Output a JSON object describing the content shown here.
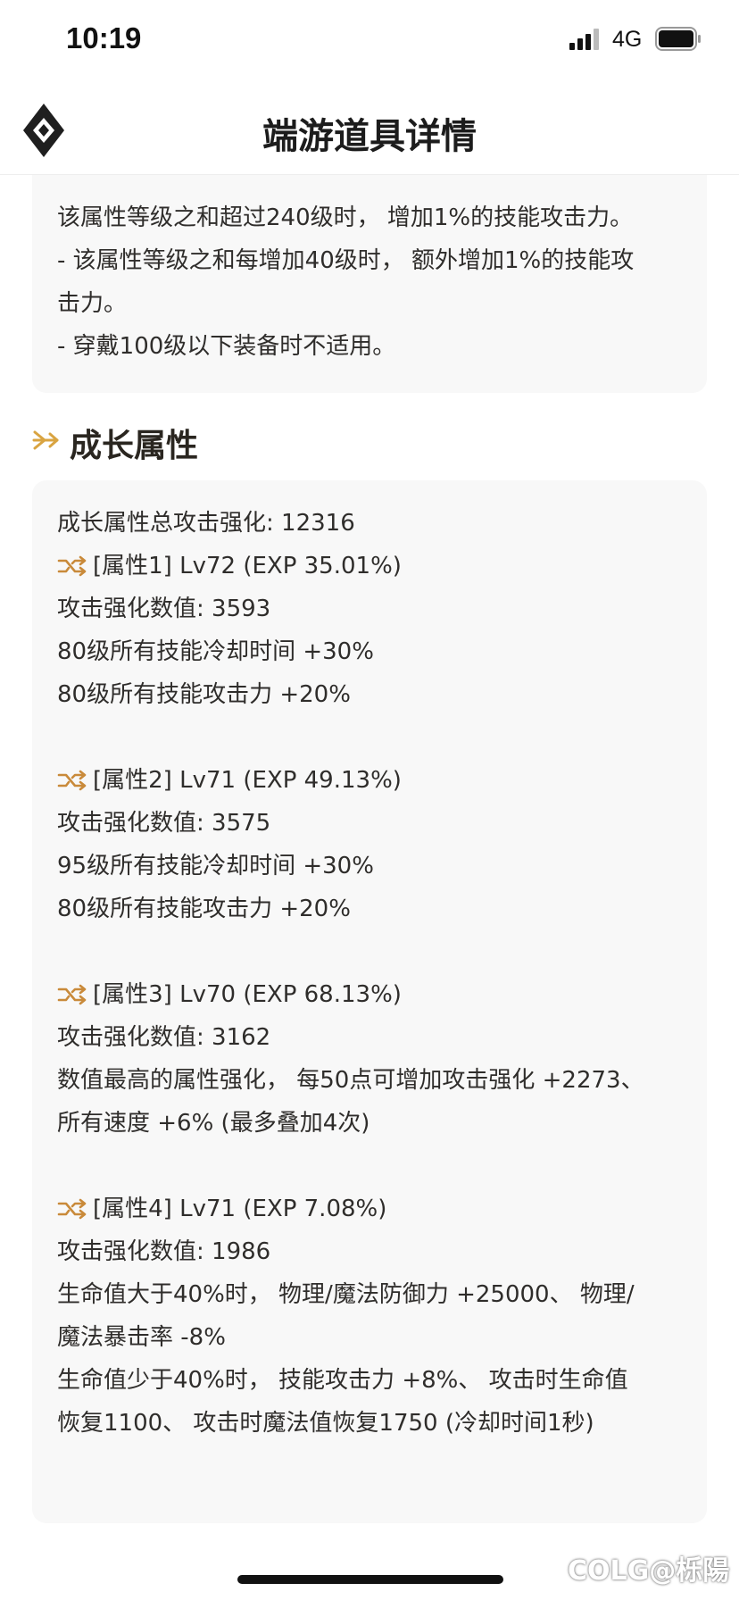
{
  "status": {
    "time": "10:19",
    "network": "4G"
  },
  "nav": {
    "title": "端游道具详情",
    "logo_icon": "diamond-logo-icon"
  },
  "desc": {
    "lines": [
      "该属性等级之和超过240级时， 增加1%的技能攻击力。",
      "- 该属性等级之和每增加40级时， 额外增加1%的技能攻",
      "击力。",
      "- 穿戴100级以下装备时不适用。"
    ]
  },
  "section": {
    "title": "成长属性",
    "icon": "arrow-right-icon"
  },
  "growth": {
    "total": "成长属性总攻击强化: 12316",
    "attrs": [
      {
        "head": "[属性1] Lv72 (EXP 35.01%)",
        "lines": [
          "攻击强化数值:  3593",
          "80级所有技能冷却时间 +30%",
          "80级所有技能攻击力 +20%"
        ]
      },
      {
        "head": "[属性2] Lv71 (EXP 49.13%)",
        "lines": [
          "攻击强化数值:  3575",
          "95级所有技能冷却时间 +30%",
          "80级所有技能攻击力 +20%"
        ]
      },
      {
        "head": "[属性3] Lv70 (EXP 68.13%)",
        "lines": [
          "攻击强化数值:  3162",
          "数值最高的属性强化， 每50点可增加攻击强化 +2273、",
          "所有速度 +6% (最多叠加4次)"
        ]
      },
      {
        "head": "[属性4] Lv71 (EXP 7.08%)",
        "lines": [
          "攻击强化数值:  1986",
          "生命值大于40%时， 物理/魔法防御力 +25000、 物理/",
          "魔法暴击率 -8%",
          "生命值少于40%时， 技能攻击力 +8%、 攻击时生命值",
          "恢复1100、 攻击时魔法值恢复1750 (冷却时间1秒)"
        ]
      }
    ],
    "attr_icon": "shuffle-icon"
  },
  "watermark": "COLG@栎陽",
  "colors": {
    "accent": "#d9a441",
    "card_bg": "#f8f8f8",
    "text": "#2f2d2b"
  }
}
